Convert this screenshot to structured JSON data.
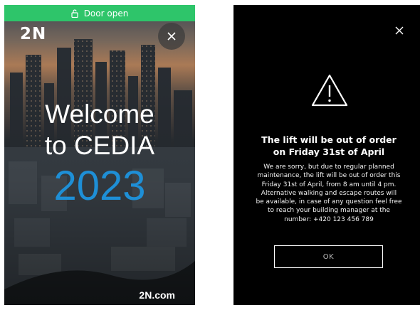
{
  "colors": {
    "status_green": "#2ec56a",
    "year_blue": "#1e8fd6",
    "screen_black": "#000000"
  },
  "left_screen": {
    "status_icon": "lock-open-icon",
    "status_text": "Door open",
    "brand": "2N",
    "close_icon": "close-icon",
    "welcome_line1": "Welcome",
    "welcome_line2": "to CEDIA",
    "year": "2023",
    "url": "2N.com"
  },
  "right_screen": {
    "close_icon": "close-icon",
    "warning_icon": "warning-icon",
    "title_line1": "The lift will be out of order",
    "title_line2": "on Friday 31st of April",
    "body_lines": [
      "We are sorry,  but due to regular planned",
      "maintenance, the lift will be out of order this",
      "Friday 31st of April, from 8 am until 4 pm.",
      "Alternative walking and escape routes will",
      "be available, in case of any question feel free",
      "to reach your building manager at the",
      "number: +420 123 456 789"
    ],
    "ok_label": "OK"
  }
}
